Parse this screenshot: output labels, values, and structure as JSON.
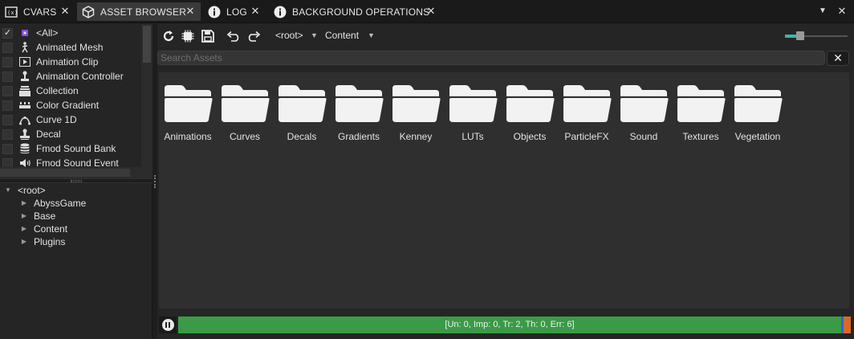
{
  "tabs": [
    {
      "label": "CVARS",
      "icon": "terminal-icon",
      "active": false
    },
    {
      "label": "ASSET BROWSER",
      "icon": "cube-icon",
      "active": true
    },
    {
      "label": "LOG",
      "icon": "info-icon",
      "active": false
    },
    {
      "label": "BACKGROUND OPERATIONS",
      "icon": "info-icon",
      "active": false
    }
  ],
  "asset_types": [
    {
      "label": "<All>",
      "checked": true,
      "icon": "all-icon"
    },
    {
      "label": "Animated Mesh",
      "checked": false,
      "icon": "person-icon"
    },
    {
      "label": "Animation Clip",
      "checked": false,
      "icon": "play-icon"
    },
    {
      "label": "Animation Controller",
      "checked": false,
      "icon": "joystick-icon"
    },
    {
      "label": "Collection",
      "checked": false,
      "icon": "collection-icon"
    },
    {
      "label": "Color Gradient",
      "checked": false,
      "icon": "gradient-icon"
    },
    {
      "label": "Curve 1D",
      "checked": false,
      "icon": "curve-icon"
    },
    {
      "label": "Decal",
      "checked": false,
      "icon": "stamp-icon"
    },
    {
      "label": "Fmod Sound Bank",
      "checked": false,
      "icon": "database-icon"
    },
    {
      "label": "Fmod Sound Event",
      "checked": false,
      "icon": "speaker-icon"
    }
  ],
  "tree": {
    "root": "<root>",
    "children": [
      "AbyssGame",
      "Base",
      "Content",
      "Plugins"
    ]
  },
  "toolbar": {
    "breadcrumb_root": "<root>",
    "breadcrumb_current": "Content",
    "zoom_level": 0.2
  },
  "search": {
    "placeholder": "Search Assets",
    "value": "",
    "clear_label": "✕"
  },
  "folders": [
    {
      "label": "Animations"
    },
    {
      "label": "Curves"
    },
    {
      "label": "Decals"
    },
    {
      "label": "Gradients"
    },
    {
      "label": "Kenney"
    },
    {
      "label": "LUTs"
    },
    {
      "label": "Objects"
    },
    {
      "label": "ParticleFX"
    },
    {
      "label": "Sound"
    },
    {
      "label": "Textures"
    },
    {
      "label": "Vegetation"
    }
  ],
  "status": {
    "text": "[Un: 0, Imp: 0, Tr: 2, Th: 0, Err: 6]"
  },
  "colors": {
    "accent_teal": "#3cb8a8",
    "status_green": "#3b9a47",
    "status_blue": "#3a5fc8",
    "status_orange": "#d76a2a"
  }
}
